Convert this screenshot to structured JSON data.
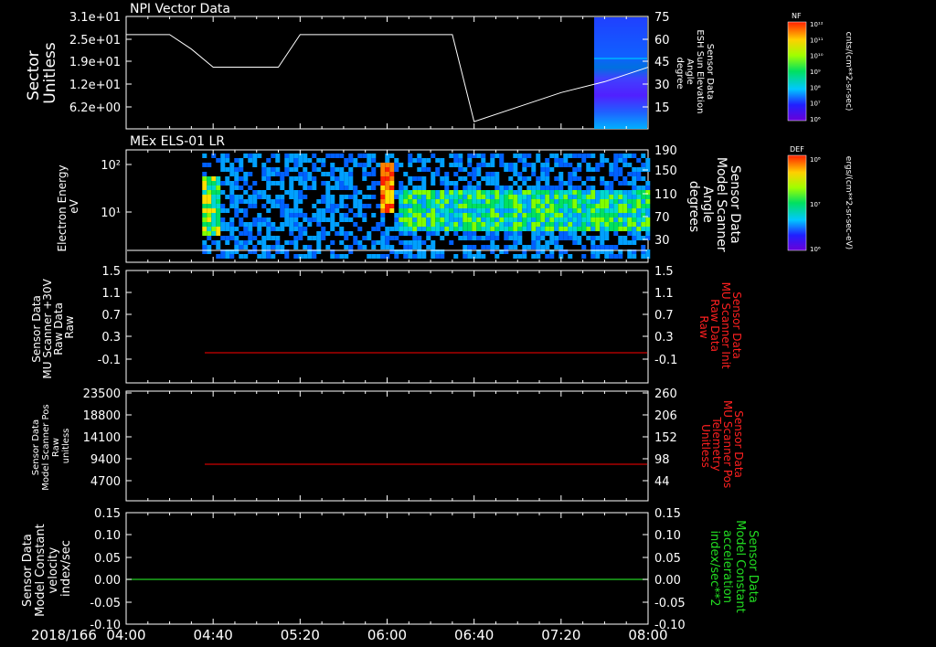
{
  "colors": {
    "background": "#000000",
    "foreground": "#ffffff",
    "red_trace": "#cc0000",
    "red_label": "#ff2020",
    "green_trace": "#22cc22",
    "green_label": "#22dd22"
  },
  "time_axis": {
    "date_label": "2018/166",
    "ticks": [
      "04:00",
      "04:40",
      "05:20",
      "06:00",
      "06:40",
      "07:20",
      "08:00"
    ]
  },
  "panels": {
    "p1": {
      "title": "NPI Vector Data",
      "left_label": [
        "Sector",
        "Unitless"
      ],
      "left_ticks": [
        "3.1e+01",
        "2.5e+01",
        "1.9e+01",
        "1.2e+01",
        "6.2e+00"
      ],
      "right_label": [
        "Sensor Data",
        "ESH Sun Elevation",
        "Angle",
        "degree"
      ],
      "right_ticks": [
        "75",
        "60",
        "45",
        "30",
        "15"
      ],
      "colorbar": {
        "title": "NF",
        "top_label": "10¹²",
        "labels": [
          "10¹²",
          "10¹¹",
          "10¹⁰",
          "10⁹",
          "10⁸",
          "10⁷",
          "10⁶"
        ],
        "units": "cnts/(cm**2-sr-sec)"
      }
    },
    "p2": {
      "title": "MEx ELS-01 LR",
      "left_label": [
        "Electron Energy",
        "eV"
      ],
      "left_ticks": [
        "10²",
        "10¹"
      ],
      "right_label": [
        "Sensor Data",
        "Model Scanner",
        "Angle",
        "degrees"
      ],
      "right_ticks": [
        "190",
        "150",
        "110",
        "70",
        "30"
      ],
      "colorbar": {
        "title": "DEF",
        "labels": [
          "10⁸",
          "10⁷",
          "10⁶"
        ],
        "units": "ergs/(cm**2-sr-sec-eV)"
      }
    },
    "p3": {
      "left_label": [
        "Sensor Data",
        "MU Scanner +30V",
        "Raw Data",
        "Raw"
      ],
      "left_ticks": [
        "1.5",
        "1.1",
        "0.7",
        "0.3",
        "-0.1"
      ],
      "right_label": [
        "Sensor Data",
        "MU Scanner Init",
        "Raw Data",
        "Raw"
      ],
      "right_ticks": [
        "1.5",
        "1.1",
        "0.7",
        "0.3",
        "-0.1"
      ]
    },
    "p4": {
      "left_label": [
        "Sensor Data",
        "Model Scanner Pos",
        "Raw",
        "unitless"
      ],
      "left_ticks": [
        "23500",
        "18800",
        "14100",
        "9400",
        "4700"
      ],
      "right_label": [
        "Sensor Data",
        "MU Scanner Pos",
        "Telemetry",
        "Unitless"
      ],
      "right_ticks": [
        "260",
        "206",
        "152",
        "98",
        "44"
      ]
    },
    "p5": {
      "left_label": [
        "Sensor Data",
        "Model Constant",
        "velocity",
        "index/sec"
      ],
      "left_ticks": [
        "0.15",
        "0.10",
        "0.05",
        "0.00",
        "-0.05",
        "-0.10"
      ],
      "right_label": [
        "Sensor Data",
        "Model Constant",
        "acceleration",
        "index/sec**2"
      ],
      "right_ticks": [
        "0.15",
        "0.10",
        "0.05",
        "0.00",
        "-0.05",
        "-0.10"
      ]
    }
  },
  "chart_data": [
    {
      "type": "line",
      "panel": "p1",
      "title": "NPI Vector Data",
      "x_unit": "time (HH:MM)",
      "x": [
        "04:00",
        "04:20",
        "04:30",
        "04:40",
        "05:10",
        "05:20",
        "06:00",
        "06:30",
        "06:40",
        "07:00",
        "07:20",
        "07:40",
        "08:00"
      ],
      "values": [
        26,
        26,
        22,
        17,
        17,
        26,
        26,
        26,
        2,
        6,
        10,
        13,
        17
      ],
      "ylabel": "Sector Unitless",
      "ylim": [
        0,
        31
      ],
      "overlay_spectrogram": {
        "x_range": [
          "07:37",
          "08:00"
        ],
        "note": "Sensor Data ESH Sun Elevation Angle"
      }
    },
    {
      "type": "heatmap",
      "panel": "p2",
      "title": "MEx ELS-01 LR",
      "ylabel": "Electron Energy eV",
      "yscale": "log",
      "ylim": [
        1,
        200
      ],
      "x_range": [
        "04:35",
        "08:00"
      ],
      "features": [
        {
          "x": [
            "04:35",
            "04:40"
          ],
          "level": "high (green-yellow)"
        },
        {
          "x": [
            "05:55",
            "06:03"
          ],
          "energy_eV": [
            20,
            150
          ],
          "level": "peak (red)"
        },
        {
          "x": [
            "06:05",
            "08:00"
          ],
          "energy_eV": [
            5,
            30
          ],
          "level": "medium (green-yellow)"
        }
      ],
      "colorbar": "DEF ergs/(cm**2-sr-sec-eV)"
    },
    {
      "type": "line",
      "panel": "p3",
      "series": [
        {
          "name": "Sensor Data MU Scanner Init Raw Data Raw",
          "x": [
            "04:38",
            "08:00"
          ],
          "values": [
            0.0,
            0.0
          ]
        }
      ],
      "ylim": [
        -0.35,
        1.5
      ]
    },
    {
      "type": "line",
      "panel": "p4",
      "series": [
        {
          "name": "Sensor Data MU Scanner Pos Telemetry Unitless",
          "x": [
            "04:38",
            "08:00"
          ],
          "values": [
            98,
            98
          ]
        }
      ],
      "ylim_right": [
        0,
        260
      ]
    },
    {
      "type": "line",
      "panel": "p5",
      "series": [
        {
          "name": "Sensor Data Model Constant acceleration index/sec**2",
          "x": [
            "04:00",
            "08:00"
          ],
          "values": [
            0.0,
            0.0
          ]
        }
      ],
      "ylim": [
        -0.1,
        0.15
      ]
    }
  ]
}
